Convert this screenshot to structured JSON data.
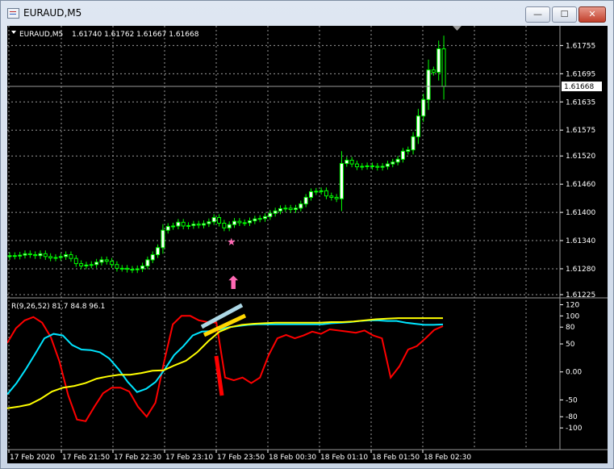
{
  "window": {
    "title": "EURAUD,M5",
    "minimize_label": "—",
    "maximize_label": "☐",
    "close_label": "✕"
  },
  "price_panel": {
    "label_symbol": "EURAUD,M5",
    "label_ohlc": "1.61740 1.61762 1.61667 1.61668",
    "price_ticks": [
      "1.61755",
      "1.61695",
      "1.61635",
      "1.61575",
      "1.61520",
      "1.61460",
      "1.61400",
      "1.61340",
      "1.61280",
      "1.61225"
    ],
    "current_price": "1.61668"
  },
  "indicator_panel": {
    "label": "R(9,26,52) 81.7 84.8 96.1",
    "level_ticks": [
      "120",
      "100",
      "80",
      "50",
      "0.00",
      "-50",
      "-80",
      "-100"
    ]
  },
  "time_axis": [
    "17 Feb 2020",
    "17 Feb 21:50",
    "17 Feb 22:30",
    "17 Feb 23:10",
    "17 Feb 23:50",
    "18 Feb 00:30",
    "18 Feb 01:10",
    "18 Feb 01:50",
    "18 Feb 02:30"
  ],
  "annotations": {
    "star_glyph": "★",
    "arrow_glyph": "⬆"
  },
  "colors": {
    "background": "#000000",
    "grid": "#9a9a9a",
    "candle": "#00ff00",
    "bull_body": "#ffffff",
    "rsi_fast": "#ff0000",
    "rsi_mid": "#00e5ff",
    "rsi_slow": "#ffff00",
    "marker_pink": "#ff69b4",
    "annotation_blue": "#add8e6",
    "annotation_yellow": "#ffd700",
    "annotation_red": "#ff0000"
  },
  "chart_data": [
    {
      "type": "candlestick",
      "title": "EURAUD,M5",
      "ylim": [
        1.61225,
        1.6179
      ],
      "closes": [
        1.61308,
        1.61307,
        1.61309,
        1.61312,
        1.6131,
        1.61308,
        1.61312,
        1.61306,
        1.61303,
        1.61304,
        1.61306,
        1.6131,
        1.61302,
        1.61291,
        1.61286,
        1.61288,
        1.61289,
        1.61294,
        1.61299,
        1.61296,
        1.61289,
        1.61281,
        1.61281,
        1.61279,
        1.61278,
        1.6128,
        1.61286,
        1.61299,
        1.6131,
        1.61325,
        1.61362,
        1.6137,
        1.61371,
        1.61379,
        1.61371,
        1.61372,
        1.61375,
        1.61373,
        1.61376,
        1.6138,
        1.61389,
        1.61377,
        1.61367,
        1.61374,
        1.61381,
        1.61378,
        1.61378,
        1.61382,
        1.61386,
        1.61387,
        1.61391,
        1.61398,
        1.61403,
        1.61408,
        1.61409,
        1.61406,
        1.61409,
        1.61418,
        1.61432,
        1.61444,
        1.61445,
        1.61446,
        1.61435,
        1.61432,
        1.61429,
        1.61504,
        1.61511,
        1.61503,
        1.61497,
        1.61498,
        1.61499,
        1.61498,
        1.61496,
        1.61498,
        1.61503,
        1.61507,
        1.61513,
        1.6153,
        1.61533,
        1.61561,
        1.61605,
        1.6164,
        1.61703,
        1.61698,
        1.61748,
        1.61668
      ]
    },
    {
      "type": "line",
      "series": [
        {
          "name": "R(9)",
          "values": [
            52,
            78,
            92,
            98,
            88,
            62,
            18,
            -42,
            -85,
            -88,
            -62,
            -38,
            -28,
            -28,
            -35,
            -62,
            -80,
            -55,
            18,
            85,
            100,
            100,
            92,
            89,
            88,
            -10,
            -15,
            -10,
            -20,
            -10,
            30,
            60,
            66,
            60,
            65,
            72,
            68,
            76,
            74,
            72,
            70,
            74,
            65,
            60,
            -10,
            10,
            40,
            46,
            60,
            75,
            81.7
          ]
        },
        {
          "name": "R(26)",
          "values": [
            -40,
            -20,
            5,
            32,
            60,
            68,
            65,
            48,
            40,
            39,
            35,
            24,
            5,
            -18,
            -36,
            -30,
            -18,
            5,
            30,
            46,
            65,
            72,
            73,
            76,
            80,
            82,
            84,
            85,
            85,
            85,
            85,
            85,
            85,
            85,
            85,
            87,
            88,
            89,
            91,
            92,
            92,
            91,
            91,
            88,
            86,
            84,
            84,
            84.8
          ]
        },
        {
          "name": "R(52)",
          "values": [
            -65,
            -62,
            -58,
            -48,
            -35,
            -28,
            -25,
            -20,
            -12,
            -8,
            -5,
            -5,
            -2,
            2,
            3,
            12,
            20,
            35,
            55,
            72,
            80,
            84,
            86,
            87,
            88,
            88,
            88,
            88,
            88,
            89,
            89,
            90,
            92,
            94,
            95,
            96,
            96,
            96,
            96,
            96.1
          ]
        }
      ],
      "ylim": [
        -120,
        125
      ]
    }
  ]
}
